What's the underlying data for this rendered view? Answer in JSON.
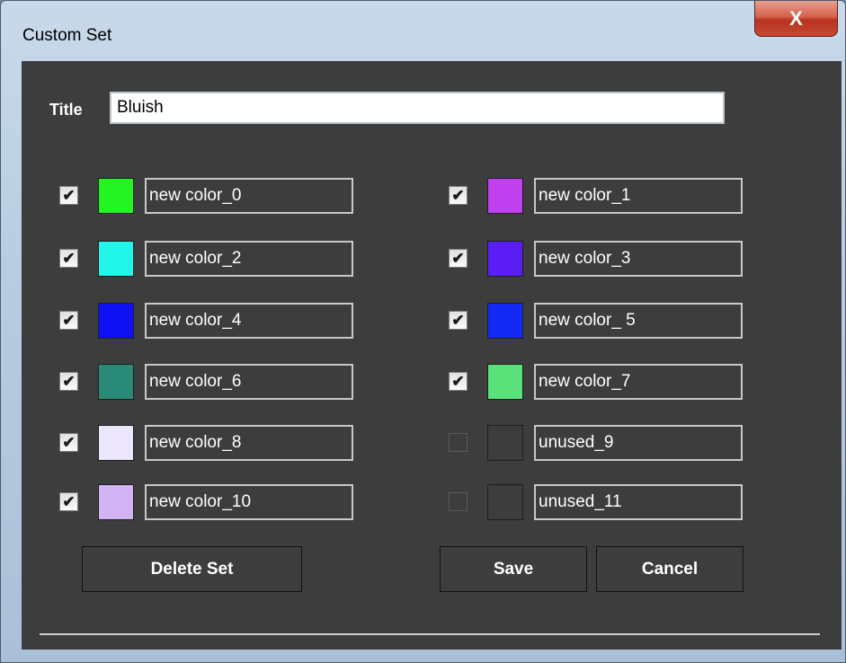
{
  "window": {
    "title": "Custom Set",
    "close_glyph": "X"
  },
  "form": {
    "title_label": "Title",
    "title_value": "Bluish"
  },
  "colors": [
    {
      "name": "new color_0",
      "checked": true,
      "color": "#22f522"
    },
    {
      "name": "new color_1",
      "checked": true,
      "color": "#c040f0"
    },
    {
      "name": "new color_2",
      "checked": true,
      "color": "#22f5ea"
    },
    {
      "name": "new color_3",
      "checked": true,
      "color": "#5a1ef5"
    },
    {
      "name": "new color_4",
      "checked": true,
      "color": "#1010f5"
    },
    {
      "name": "new color_ 5",
      "checked": true,
      "color": "#1428f5"
    },
    {
      "name": "new color_6",
      "checked": true,
      "color": "#2a8a78"
    },
    {
      "name": "new color_7",
      "checked": true,
      "color": "#5ae27a"
    },
    {
      "name": "new color_8",
      "checked": true,
      "color": "#ece6fc"
    },
    {
      "name": "unused_9",
      "checked": false,
      "color": "#3d3d3d"
    },
    {
      "name": "new color_10",
      "checked": true,
      "color": "#d2b4f5"
    },
    {
      "name": "unused_11",
      "checked": false,
      "color": "#3d3d3d"
    }
  ],
  "buttons": {
    "delete": "Delete Set",
    "save": "Save",
    "cancel": "Cancel"
  }
}
